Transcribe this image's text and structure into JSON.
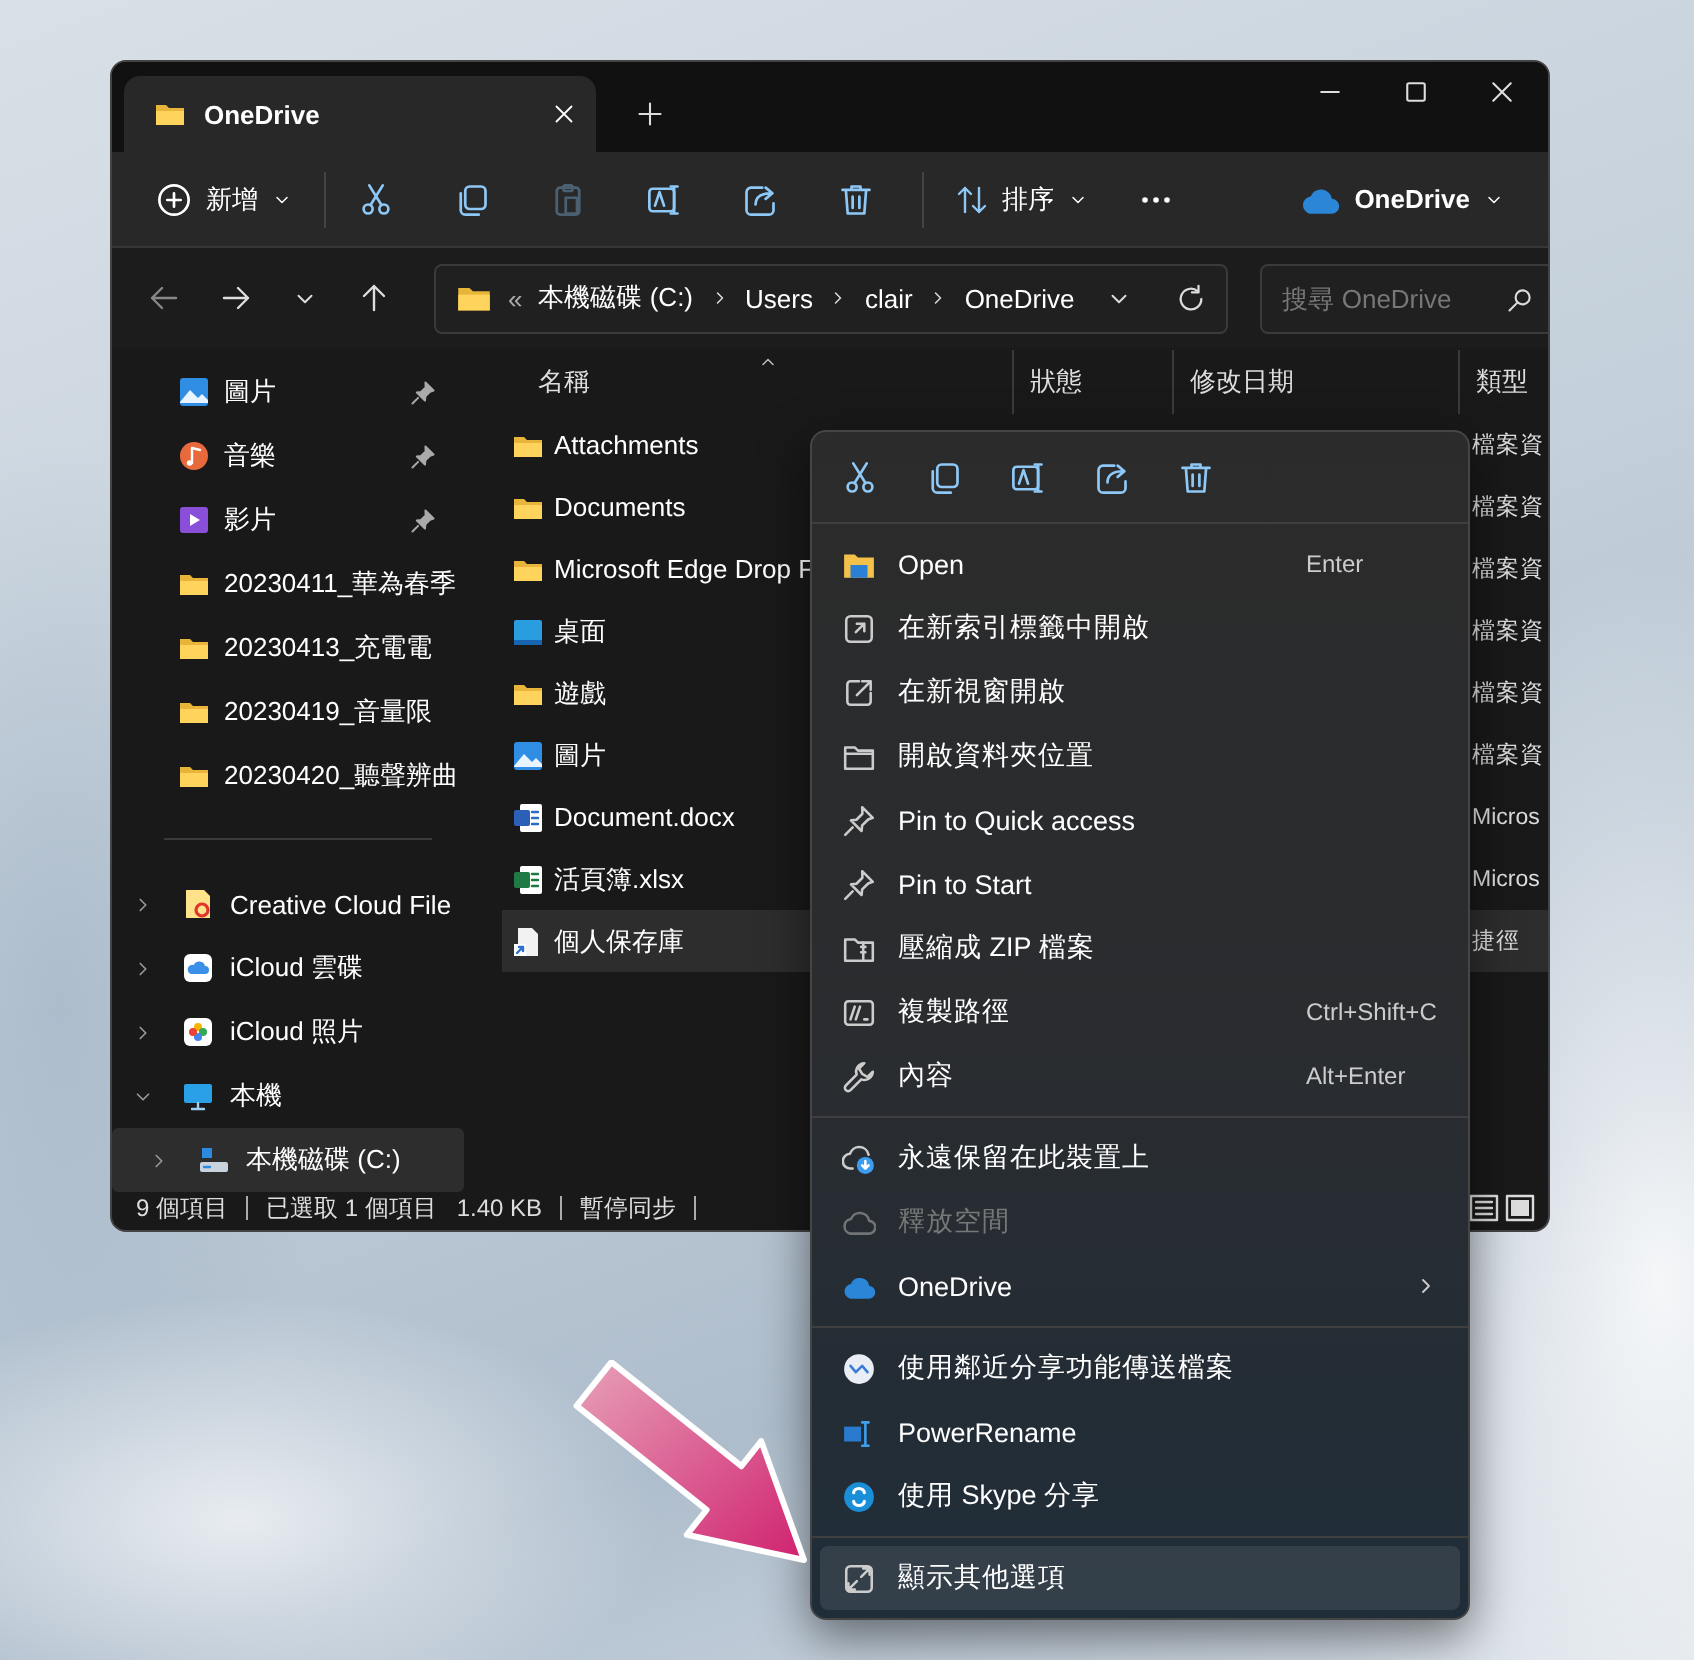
{
  "window": {
    "tabs": [
      {
        "title": "OneDrive",
        "selected": true
      }
    ]
  },
  "toolbar": {
    "new_label": "新增",
    "sort_label": "排序",
    "icon_buttons": [
      {
        "disabled": false
      },
      {
        "disabled": false
      },
      {
        "disabled": true
      },
      {
        "disabled": false
      },
      {
        "disabled": false
      },
      {
        "disabled": false
      }
    ],
    "account_label": "OneDrive"
  },
  "address_bar": {
    "overflow": "«",
    "segments": [
      "本機磁碟 (C:)",
      "Users",
      "clair",
      "OneDrive"
    ]
  },
  "search": {
    "placeholder": "搜尋 OneDrive"
  },
  "sidebar": {
    "quick_access": [
      {
        "label": "圖片",
        "pinned": true
      },
      {
        "label": "音樂",
        "pinned": true
      },
      {
        "label": "影片",
        "pinned": true
      },
      {
        "label": "20230411_華為春季",
        "pinned": false
      },
      {
        "label": "20230413_充電電",
        "pinned": false
      },
      {
        "label": "20230419_音量限",
        "pinned": false
      },
      {
        "label": "20230420_聽聲辨曲",
        "pinned": false
      }
    ],
    "tree": [
      {
        "label": "Creative Cloud File",
        "expanded": false,
        "selected": false
      },
      {
        "label": "iCloud 雲碟",
        "expanded": false,
        "selected": false
      },
      {
        "label": "iCloud 照片",
        "expanded": false,
        "selected": false
      },
      {
        "label": "本機",
        "expanded": true,
        "selected": false,
        "children": [
          {
            "label": "本機磁碟 (C:)",
            "expanded": false,
            "selected": true
          }
        ]
      }
    ]
  },
  "file_list": {
    "columns": [
      "名稱",
      "狀態",
      "修改日期",
      "類型"
    ],
    "rows": [
      {
        "name": "Attachments",
        "type": "檔案資",
        "selected": false
      },
      {
        "name": "Documents",
        "type": "檔案資",
        "selected": false
      },
      {
        "name": "Microsoft Edge Drop F",
        "type": "檔案資",
        "selected": false
      },
      {
        "name": "桌面",
        "type": "檔案資",
        "selected": false
      },
      {
        "name": "遊戲",
        "type": "檔案資",
        "selected": false
      },
      {
        "name": "圖片",
        "type": "檔案資",
        "selected": false
      },
      {
        "name": "Document.docx",
        "type": "Micros",
        "selected": false
      },
      {
        "name": "活頁簿.xlsx",
        "type": "Micros",
        "selected": false
      },
      {
        "name": "個人保存庫",
        "type": "捷徑",
        "selected": true
      }
    ]
  },
  "status_bar": {
    "groups": [
      [
        "9 個項目"
      ],
      [
        "已選取 1 個項目",
        "1.40 KB"
      ],
      [
        "暫停同步"
      ]
    ]
  },
  "context_menu": {
    "groups": [
      {
        "items": [
          {
            "kind": "item",
            "label": "Open",
            "shortcut": "Enter",
            "disabled": false,
            "selected": false
          },
          {
            "kind": "item",
            "label": "在新索引標籤中開啟",
            "disabled": false,
            "selected": false
          },
          {
            "kind": "item",
            "label": "在新視窗開啟",
            "disabled": false,
            "selected": false
          },
          {
            "kind": "item",
            "label": "開啟資料夾位置",
            "disabled": false,
            "selected": false
          },
          {
            "kind": "item",
            "label": "Pin to Quick access",
            "disabled": false,
            "selected": false
          },
          {
            "kind": "item",
            "label": "Pin to Start",
            "disabled": false,
            "selected": false
          },
          {
            "kind": "item",
            "label": "壓縮成 ZIP 檔案",
            "disabled": false,
            "selected": false
          },
          {
            "kind": "item",
            "label": "複製路徑",
            "shortcut": "Ctrl+Shift+C",
            "disabled": false,
            "selected": false
          },
          {
            "kind": "item",
            "label": "內容",
            "shortcut": "Alt+Enter",
            "disabled": false,
            "selected": false
          }
        ]
      },
      {
        "items": [
          {
            "kind": "item",
            "label": "永遠保留在此裝置上",
            "disabled": false,
            "selected": false
          },
          {
            "kind": "item",
            "label": "釋放空間",
            "disabled": true,
            "selected": false
          },
          {
            "kind": "submenu",
            "label": "OneDrive",
            "disabled": false,
            "selected": false
          }
        ]
      },
      {
        "items": [
          {
            "kind": "item",
            "label": "使用鄰近分享功能傳送檔案",
            "disabled": false,
            "selected": false
          },
          {
            "kind": "item",
            "label": "PowerRename",
            "disabled": false,
            "selected": false
          },
          {
            "kind": "item",
            "label": "使用 Skype 分享",
            "disabled": false,
            "selected": false
          }
        ]
      },
      {
        "items": [
          {
            "kind": "item",
            "label": "顯示其他選項",
            "disabled": false,
            "selected": true
          }
        ]
      }
    ]
  }
}
